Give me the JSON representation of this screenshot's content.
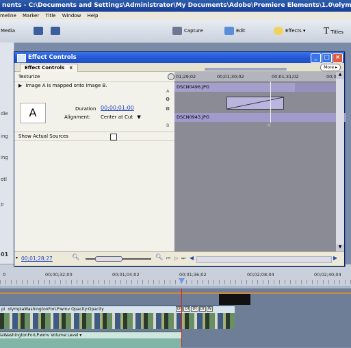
{
  "app": {
    "title": "nents - C:\\Documents and Settings\\Administrator\\My Documents\\Adobe\\Premiere Elements\\1.0\\olympiaSar",
    "menu": [
      "meline",
      "Marker",
      "Title",
      "Window",
      "Help"
    ],
    "toolbar": {
      "media_label": "Media",
      "capture_label": "Capture",
      "edit_label": "Edit",
      "effects_label": "Effects",
      "titles_label": "Titles"
    },
    "left_strip_fragments": [
      "die",
      "ing",
      "ing",
      "otl",
      "p",
      "01"
    ]
  },
  "effect_controls": {
    "window_title": "Effect Controls",
    "tab_label": "Effect Controls",
    "more_label": "More",
    "effect_name": "Texturize",
    "description": "Image A is mapped onto image B.",
    "thumbnail_letter": "A",
    "duration_label": "Duration",
    "duration_value": "00;00;01;00",
    "alignment_label": "Alignment:",
    "alignment_value": "Center at Cut",
    "show_sources_label": "Show Actual Sources",
    "show_sources_checked": false,
    "timecode": "00;01;28;27",
    "track_letters": [
      "A",
      "B"
    ],
    "clip_a": "DSCN0496.JPG",
    "clip_b": "DSCN0943.JPG",
    "mini_ruler": [
      "01;29;02",
      "00;01;30;02",
      "00;01;31;02",
      "00;0"
    ]
  },
  "timeline": {
    "ruler": [
      "00;00;32;00",
      "00;01;04;02",
      "00;01;36;02",
      "00;02;08;04",
      "00;02;40;04"
    ],
    "video_clip_label": "olympiaWashingtonForLP.wmv Opacity:Opacity",
    "video_clip_prefix": "pi",
    "fx_badges": [
      "Df",
      "Df",
      "Df",
      "Df",
      "W"
    ],
    "audio_clip_label": "iaWashingtonForLP.wmv Volume:Level"
  },
  "colors": {
    "titlebar": "#1d48a4",
    "ec_titlebar": "#2458d6",
    "timecode": "#1f3fbf",
    "clip_b_bar": "#9a96c8",
    "playhead": "#e02020",
    "audio_track": "#7fb6a8"
  }
}
